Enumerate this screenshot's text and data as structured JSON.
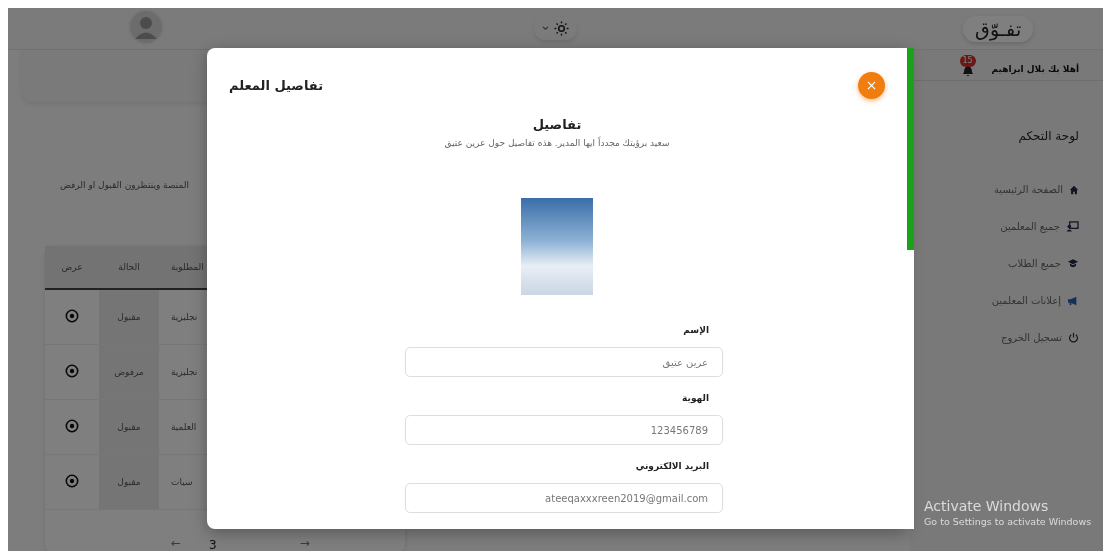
{
  "topbar": {
    "logo": "تفـوّق",
    "dark_mode": false
  },
  "sidebar": {
    "greeting": "أهلا بك بلال ابراهيم",
    "notification_count": "15",
    "heading": "لوحة التحكم",
    "items": [
      {
        "kind": "home",
        "label": "الصفحة الرئيسية"
      },
      {
        "kind": "teacher",
        "label": "جميع المعلمين"
      },
      {
        "kind": "student",
        "label": "جميع الطلاب"
      },
      {
        "kind": "megaphone",
        "label": "إعلانات المعلمين"
      },
      {
        "kind": "power",
        "label": "تسجيل الخروج"
      }
    ]
  },
  "main": {
    "description": "المنصة وينتظرون القبول او الرفض",
    "table": {
      "columns": [
        "المطلوبة",
        "الحالة",
        "عرض"
      ],
      "rows": [
        [
          "نجليزية",
          "مقبول"
        ],
        [
          "نجليزية",
          "مرفوض"
        ],
        [
          "العلمية",
          "مقبول"
        ],
        [
          "سيات",
          "مقبول"
        ]
      ]
    },
    "pagination": {
      "prev": "←",
      "page": "3",
      "next": "→"
    }
  },
  "modal": {
    "title": "تفاصيل المعلم",
    "heading": "تفاصيل",
    "subtitle": "سعيد برؤيتك مجدداً ايها المدير. هذه تفاصيل حول عرين عتيق",
    "fields": [
      {
        "label": "الإسم",
        "value": "عرين عتيق"
      },
      {
        "label": "الهوية",
        "value": "123456789"
      },
      {
        "label": "البريد الالكتروني",
        "value": "ateeqaxxxreen2019@gmail.com"
      }
    ]
  },
  "os_notice": {
    "title": "Activate Windows",
    "text": "Go to Settings to activate Windows"
  }
}
